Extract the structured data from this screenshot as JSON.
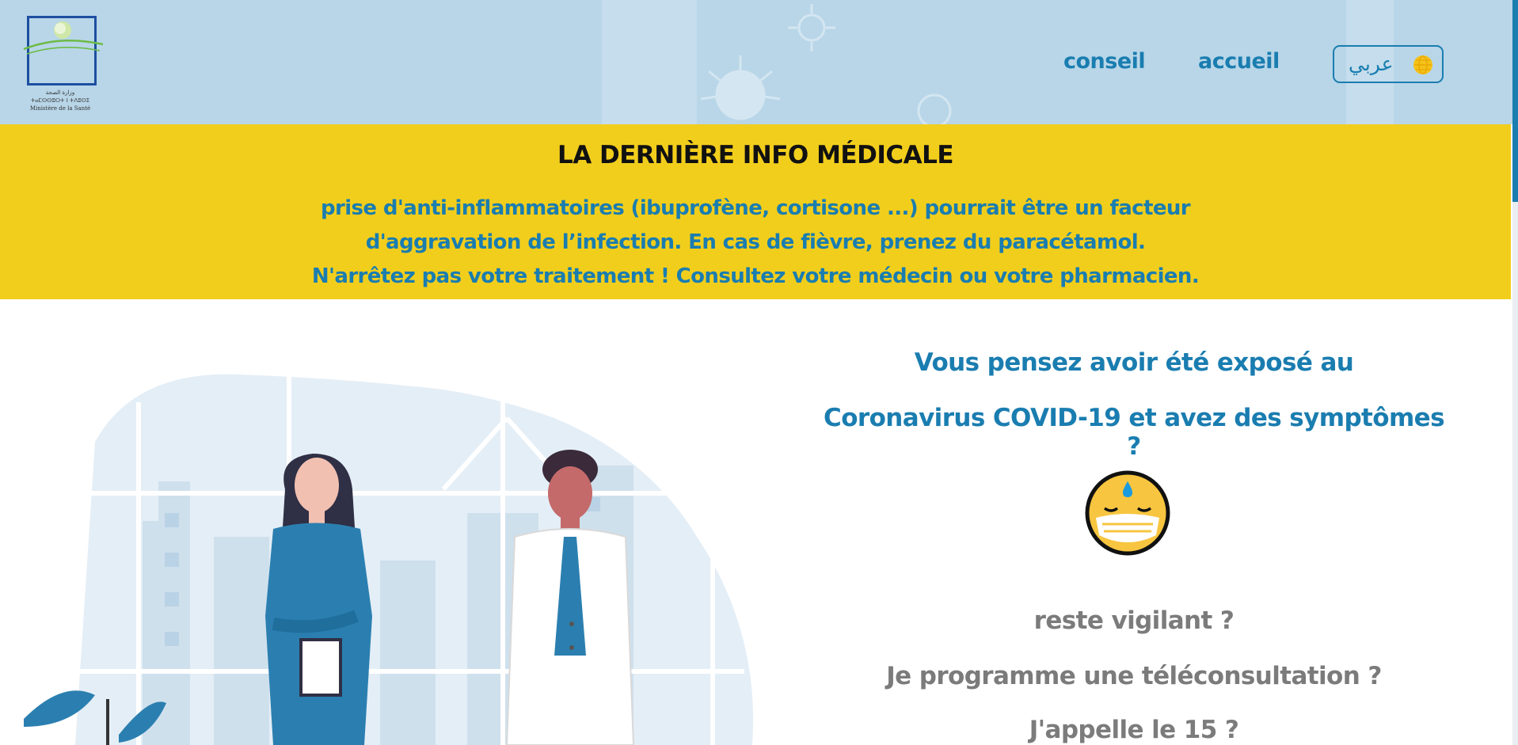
{
  "header": {
    "logo": {
      "icon": "ministry-logo",
      "line1": "وزارة الصحة",
      "line2": "ⵜⴰⵎⵙⵙⵓⵔⵜ ⵏ ⵜⴷⵓⵙⵉ",
      "line3": "Ministère de la Santé"
    },
    "nav": {
      "conseil": "conseil",
      "accueil": "accueil"
    },
    "language_button": {
      "label": "عربي",
      "icon": "globe-icon"
    }
  },
  "banner": {
    "title": "LA DERNIÈRE INFO MÉDICALE",
    "lines": [
      "prise d'anti-inflammatoires (ibuprofène, cortisone ...) pourrait être un facteur",
      "d'aggravation de l’infection. En cas de fièvre, prenez du paracétamol.",
      "N'arrêtez pas votre traitement ! Consultez votre médecin ou votre pharmacien."
    ]
  },
  "main": {
    "question_line1": "Vous pensez avoir été exposé au",
    "question_line2": "Coronavirus COVID-19 et avez des symptômes ?",
    "emoji_icon": "masked-sweating-face-icon",
    "options": [
      "reste vigilant ?",
      "Je programme une téléconsultation ?",
      "J'appelle le 15 ?"
    ]
  },
  "colors": {
    "header_bg": "#b8d6e8",
    "banner_bg": "#f2ce1c",
    "accent_blue": "#1a7db0",
    "option_gray": "#7b7b7b"
  }
}
